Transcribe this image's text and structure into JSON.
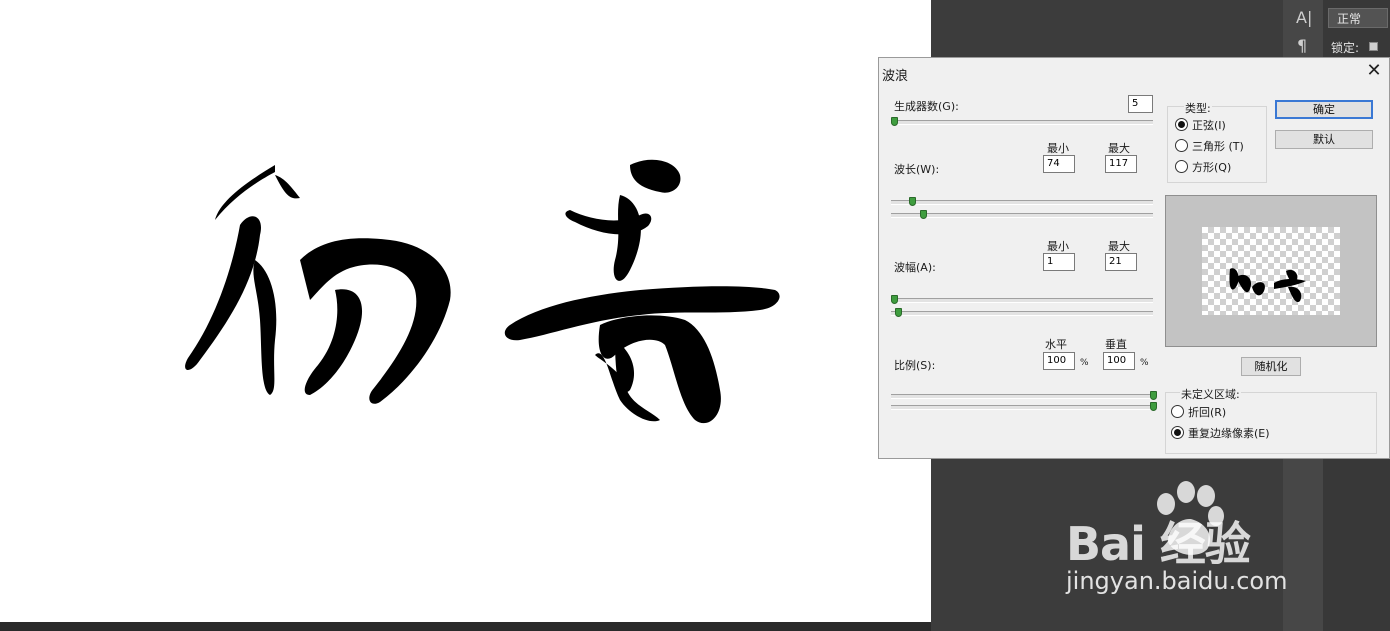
{
  "dialog": {
    "title": "波浪",
    "close": "✕",
    "generators": {
      "label": "生成器数(G):",
      "value": "5"
    },
    "wavelength": {
      "label": "波长(W):",
      "min_label": "最小",
      "max_label": "最大",
      "min": "74",
      "max": "117"
    },
    "amplitude": {
      "label": "波幅(A):",
      "min_label": "最小",
      "max_label": "最大",
      "min": "1",
      "max": "21"
    },
    "scale": {
      "label": "比例(S):",
      "h_label": "水平",
      "v_label": "垂直",
      "h": "100",
      "v": "100",
      "unit": "%"
    },
    "type": {
      "title": "类型:",
      "options": [
        "正弦(I)",
        "三角形 (T)",
        "方形(Q)"
      ],
      "selected": 0
    },
    "buttons": {
      "ok": "确定",
      "default": "默认",
      "randomize": "随机化"
    },
    "undefined_area": {
      "title": "未定义区域:",
      "options": [
        "折回(R)",
        "重复边缘像素(E)"
      ],
      "selected": 1
    }
  },
  "photoshop_panel": {
    "blend_mode": "正常",
    "lock_label": "锁定:",
    "text_icon": "A|",
    "para_icon": "¶"
  },
  "watermark": {
    "brand": "Bai 经验",
    "url": "jingyan.baidu.com"
  },
  "colors": {
    "accent": "#3a78d4",
    "thumb": "#3f9d3f"
  }
}
